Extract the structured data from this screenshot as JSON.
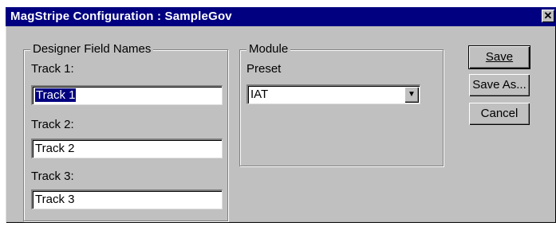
{
  "window": {
    "title": "MagStripe Configuration : SampleGov",
    "close_symbol": "✕"
  },
  "designer_group": {
    "title": "Designer Field Names",
    "track1_label": "Track 1:",
    "track1_value": "Track 1",
    "track2_label": "Track 2:",
    "track2_value": "Track 2",
    "track3_label": "Track 3:",
    "track3_value": "Track 3"
  },
  "module_group": {
    "title": "Module",
    "preset_label": "Preset",
    "preset_value": "IAT"
  },
  "buttons": {
    "save": "Save",
    "save_as": "Save As...",
    "cancel": "Cancel"
  }
}
